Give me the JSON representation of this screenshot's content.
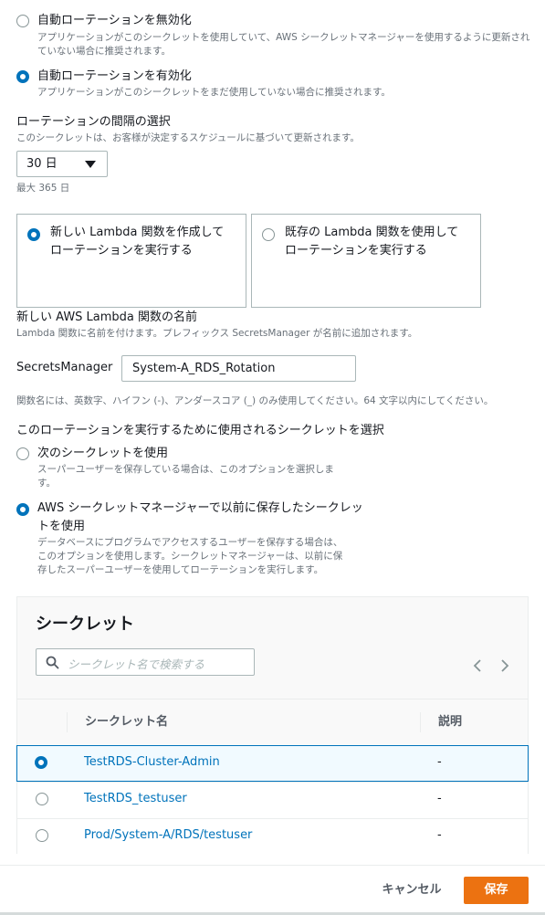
{
  "rotation": {
    "disable_label": "自動ローテーションを無効化",
    "disable_desc": "アプリケーションがこのシークレットを使用していて、AWS シークレットマネージャーを使用するように更新されていない場合に推奨されます。",
    "enable_label": "自動ローテーションを有効化",
    "enable_desc": "アプリケーションがこのシークレットをまだ使用していない場合に推奨されます。",
    "selected": "enable"
  },
  "interval": {
    "header": "ローテーションの間隔の選択",
    "desc": "このシークレットは、お客様が決定するスケジュールに基づいて更新されます。",
    "value": "30 日",
    "hint": "最大 365 日"
  },
  "lambda_choice": {
    "new_label": "新しい Lambda 関数を作成して\nローテーションを実行する",
    "existing_label": "既存の Lambda 関数を使用して\nローテーションを実行する",
    "selected": "new"
  },
  "function_name": {
    "header": "新しい AWS Lambda 関数の名前",
    "desc": "Lambda 関数に名前を付けます。プレフィックス SecretsManager が名前に追加されます。",
    "prefix": "SecretsManager",
    "value": "System-A_RDS_Rotation",
    "hint": "関数名には、英数字、ハイフン (-)、アンダースコア (_) のみ使用してください。64 文字以内にしてください。"
  },
  "secret_choice": {
    "header": "このローテーションを実行するために使用されるシークレットを選択",
    "next_label": "次のシークレットを使用",
    "next_desc": "スーパーユーザーを保存している場合は、このオプションを選択しま\nす。",
    "stored_label": "AWS シークレットマネージャーで以前に保存したシークレッ\nトを使用",
    "stored_desc": "データベースにプログラムでアクセスするユーザーを保存する場合は、\nこのオプションを使用します。シークレットマネージャーは、以前に保\n存したスーパーユーザーを使用してローテーションを実行します。",
    "selected": "stored"
  },
  "secrets_table": {
    "title": "シークレット",
    "search_placeholder": "シークレット名で検索する",
    "columns": [
      "シークレット名",
      "説明"
    ],
    "rows": [
      {
        "name": "TestRDS-Cluster-Admin",
        "description": "-",
        "selected": true
      },
      {
        "name": "TestRDS_testuser",
        "description": "-",
        "selected": false
      },
      {
        "name": "Prod/System-A/RDS/testuser",
        "description": "-",
        "selected": false
      }
    ]
  },
  "footer": {
    "cancel_label": "キャンセル",
    "save_label": "保存"
  },
  "colors": {
    "accent": "#0073bb",
    "primary_button": "#ec7211"
  }
}
